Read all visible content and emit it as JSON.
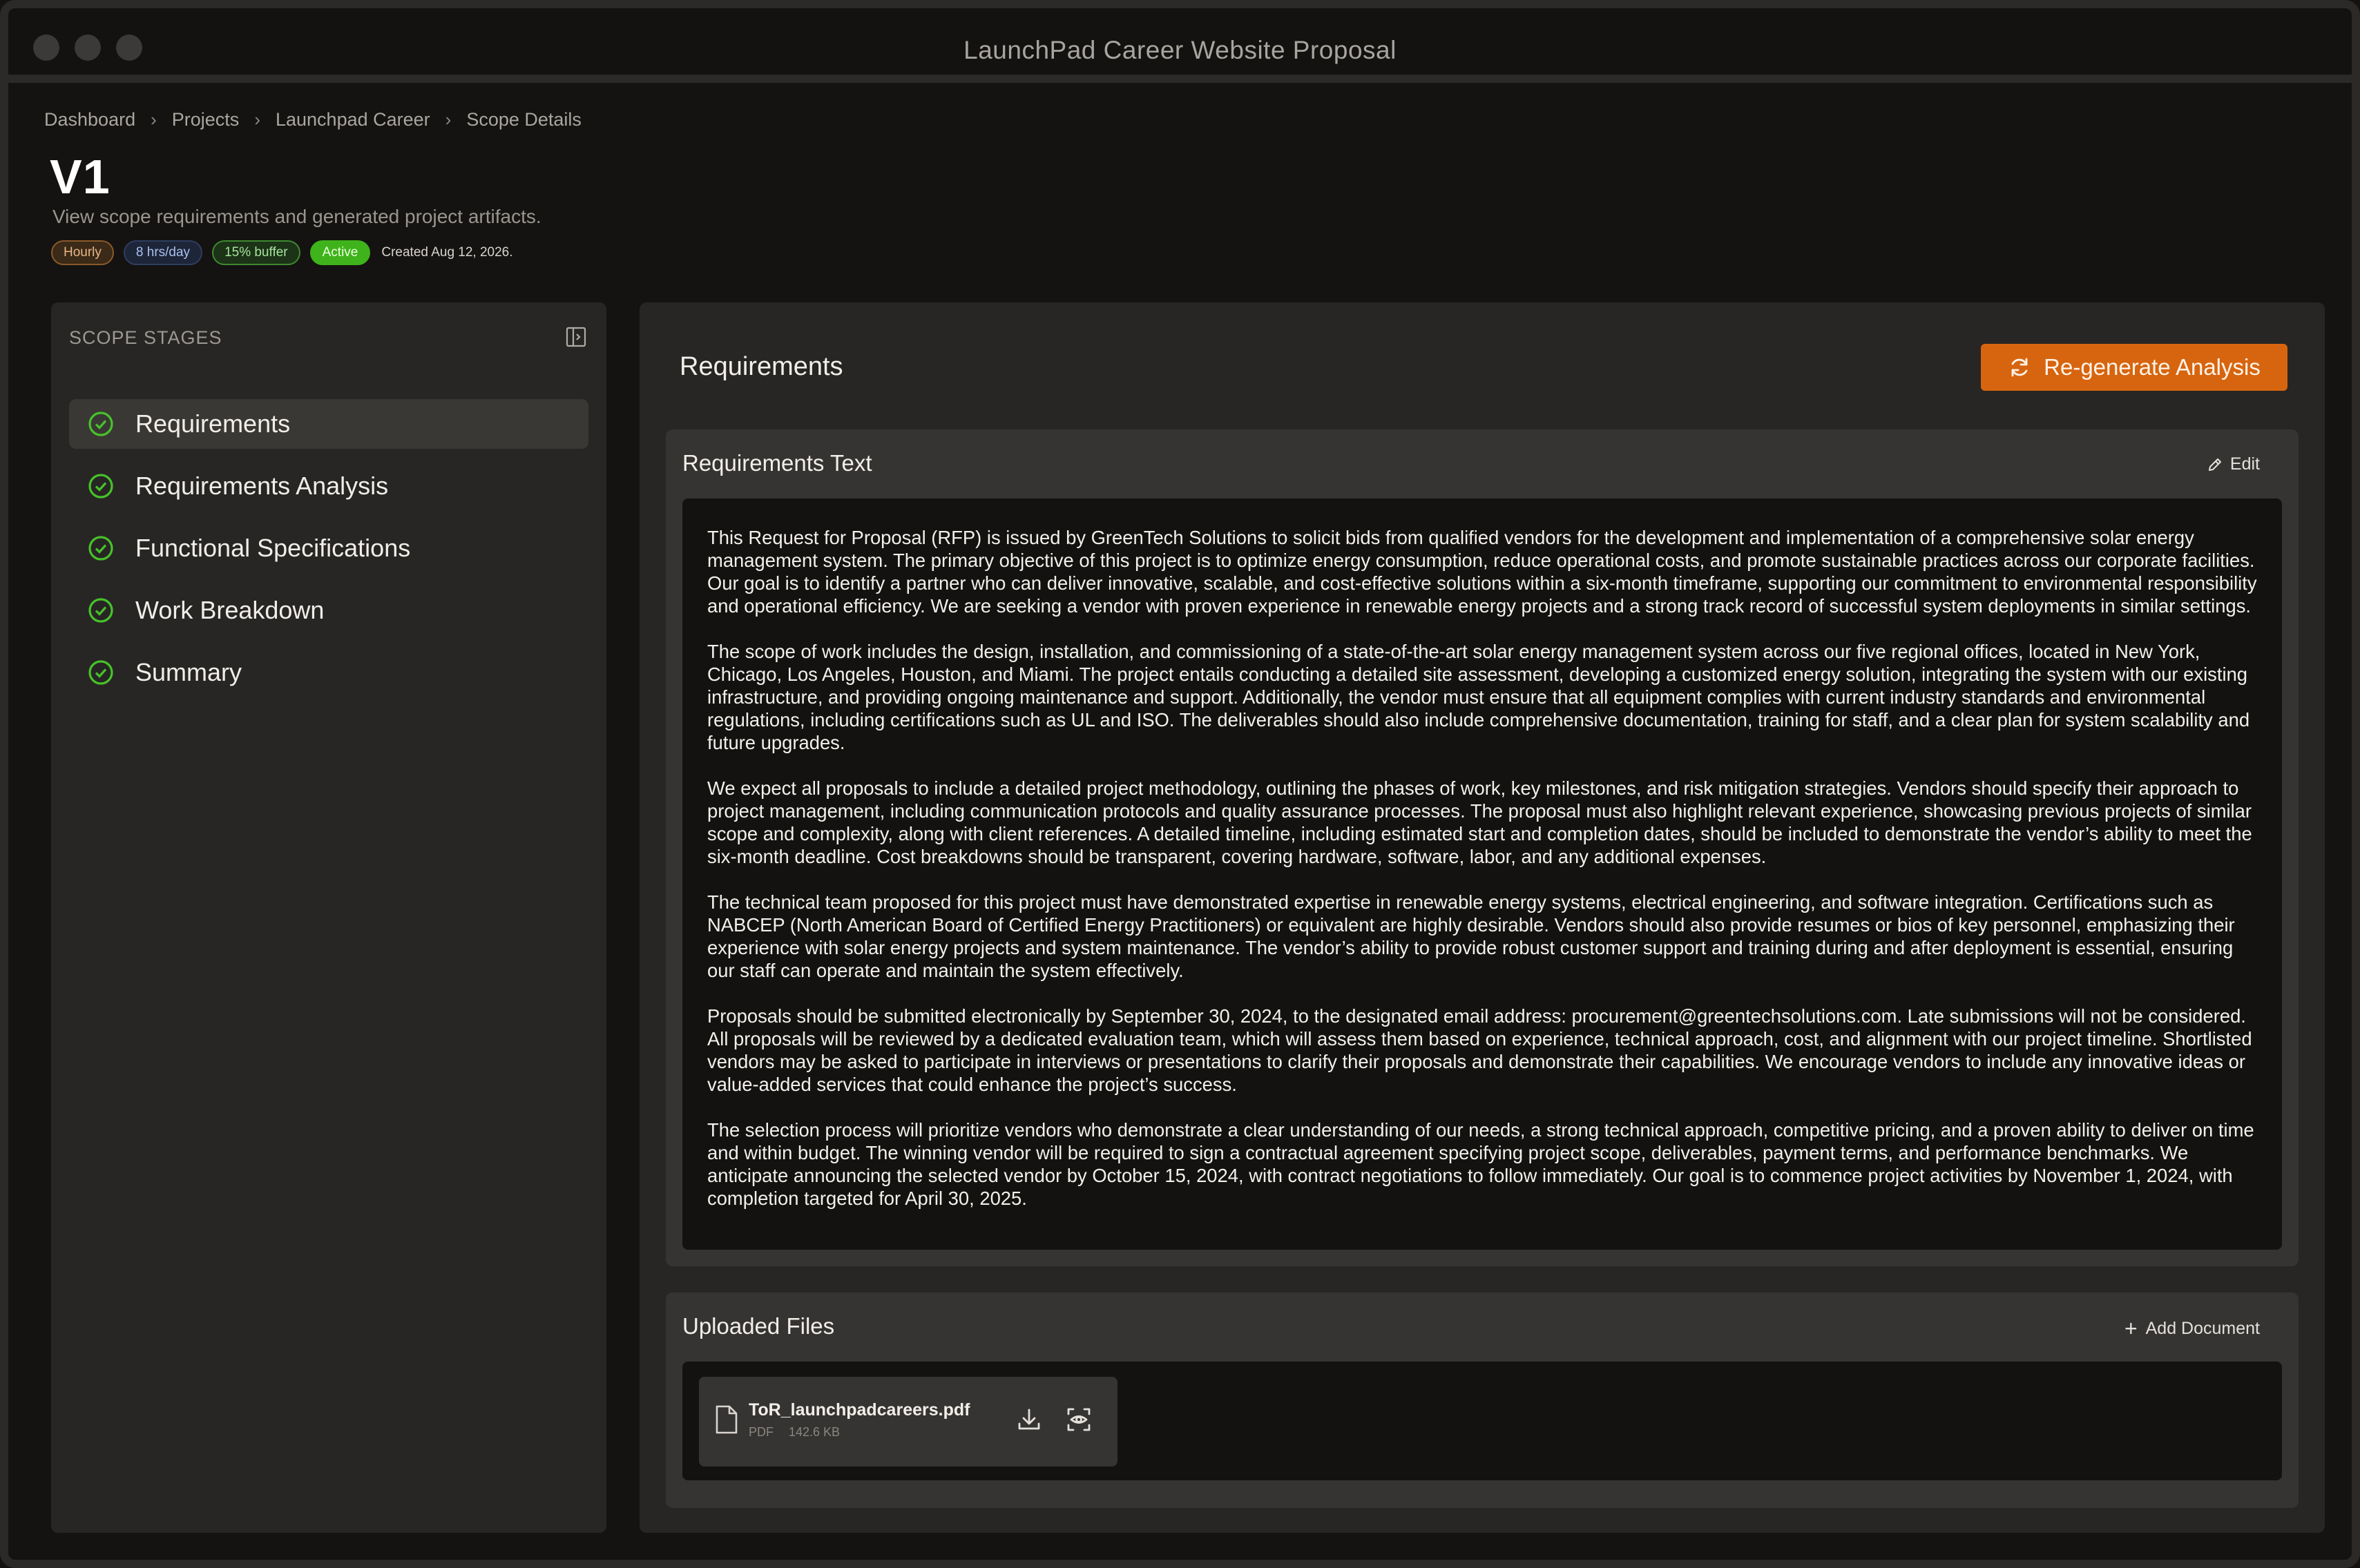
{
  "window": {
    "title": "LaunchPad Career Website Proposal"
  },
  "breadcrumb": [
    {
      "label": "Dashboard"
    },
    {
      "label": "Projects"
    },
    {
      "label": "Launchpad Career"
    },
    {
      "label": "Scope Details"
    }
  ],
  "page": {
    "title": "V1",
    "subtitle": "View scope requirements and generated project artifacts."
  },
  "badges": {
    "rate": "Hourly",
    "hours": "8 hrs/day",
    "buffer": "15% buffer",
    "status": "Active",
    "created": "Created Aug 12,  2026."
  },
  "sidebar": {
    "title": "SCOPE STAGES",
    "toggle_icon": "sidebar-collapse-icon",
    "check_icon": "check-circle-icon",
    "items": [
      {
        "label": "Requirements",
        "active": true
      },
      {
        "label": "Requirements Analysis",
        "active": false
      },
      {
        "label": "Functional Specifications",
        "active": false
      },
      {
        "label": "Work Breakdown",
        "active": false
      },
      {
        "label": "Summary",
        "active": false
      }
    ]
  },
  "main": {
    "title": "Requirements",
    "regenerate_label": "Re-generate Analysis",
    "requirements_card": {
      "title": "Requirements Text",
      "edit_label": "Edit",
      "paragraphs": [
        "This Request for Proposal (RFP) is issued by GreenTech Solutions to solicit bids from qualified vendors for the development and implementation of a comprehensive solar energy management system. The primary objective of this project is to optimize energy consumption, reduce operational costs, and promote sustainable practices across our corporate facilities. Our goal is to identify a partner who can deliver innovative, scalable, and cost-effective solutions within a six-month timeframe, supporting our commitment to environmental responsibility and operational efficiency. We are seeking a vendor with proven experience in renewable energy projects and a strong track record of successful system deployments in similar settings.",
        "The scope of work includes the design, installation, and commissioning of a state-of-the-art solar energy management system across our five regional offices, located in New York, Chicago, Los Angeles, Houston, and Miami. The project entails conducting a detailed site assessment, developing a customized energy solution, integrating the system with our existing infrastructure, and providing ongoing maintenance and support. Additionally, the vendor must ensure that all equipment complies with current industry standards and environmental regulations, including certifications such as UL and ISO. The deliverables should also include comprehensive documentation, training for staff, and a clear plan for system scalability and future upgrades.",
        "We expect all proposals to include a detailed project methodology, outlining the phases of work, key milestones, and risk mitigation strategies. Vendors should specify their approach to project management, including communication protocols and quality assurance processes. The proposal must also highlight relevant experience, showcasing previous projects of similar scope and complexity, along with client references. A detailed timeline, including estimated start and completion dates, should be included to demonstrate the vendor’s ability to meet the six-month deadline. Cost breakdowns should be transparent, covering hardware, software, labor, and any additional expenses.",
        "The technical team proposed for this project must have demonstrated expertise in renewable energy systems, electrical engineering, and software integration. Certifications such as NABCEP (North American Board of Certified Energy Practitioners) or equivalent are highly desirable. Vendors should also provide resumes or bios of key personnel, emphasizing their experience with solar energy projects and system maintenance. The vendor’s ability to provide robust customer support and training during and after deployment is essential, ensuring our staff can operate and maintain the system effectively.",
        "Proposals should be submitted electronically by September 30, 2024, to the designated email address: procurement@greentechsolutions.com. Late submissions will not be considered. All proposals will be reviewed by a dedicated evaluation team, which will assess them based on experience, technical approach, cost, and alignment with our project timeline. Shortlisted vendors may be asked to participate in interviews or presentations to clarify their proposals and demonstrate their capabilities. We encourage vendors to include any innovative ideas or value-added services that could enhance the project’s success.",
        "The selection process will prioritize vendors who demonstrate a clear understanding of our needs, a strong technical approach, competitive pricing, and a proven ability to deliver on time and within budget. The winning vendor will be required to sign a contractual agreement specifying project scope, deliverables, payment terms, and performance benchmarks. We anticipate announcing the selected vendor by October 15, 2024, with contract negotiations to follow immediately. Our goal is to commence project activities by November 1, 2024, with completion targeted for April 30, 2025."
      ]
    },
    "files_card": {
      "title": "Uploaded Files",
      "add_label": "Add Document",
      "files": [
        {
          "name": "ToR_launchpadcareers.pdf",
          "type": "PDF",
          "size": "142.6 KB"
        }
      ]
    }
  },
  "colors": {
    "accent": "#d7650f",
    "success": "#3fb31b",
    "background": "#141311",
    "panel": "#272624",
    "card": "#363432"
  }
}
